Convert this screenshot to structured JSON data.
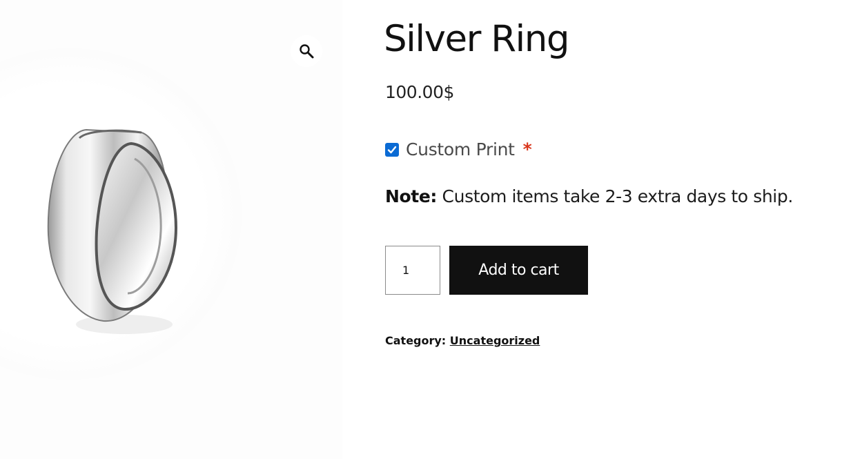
{
  "product": {
    "title": "Silver Ring",
    "price": "100.00$"
  },
  "option": {
    "label": "Custom Print",
    "required_mark": "*",
    "checked": true
  },
  "note": {
    "label": "Note:",
    "text": " Custom items take 2-3 extra days to ship."
  },
  "cart": {
    "quantity": "1",
    "add_label": "Add to cart"
  },
  "meta": {
    "category_label": "Category:",
    "category_value": "Uncategorized"
  },
  "icons": {
    "zoom": "magnifier-icon",
    "checkbox": "checkmark-icon"
  },
  "colors": {
    "button_bg": "#111111",
    "button_text": "#ffffff",
    "checkbox": "#0b6bd4",
    "required": "#d9351b"
  }
}
